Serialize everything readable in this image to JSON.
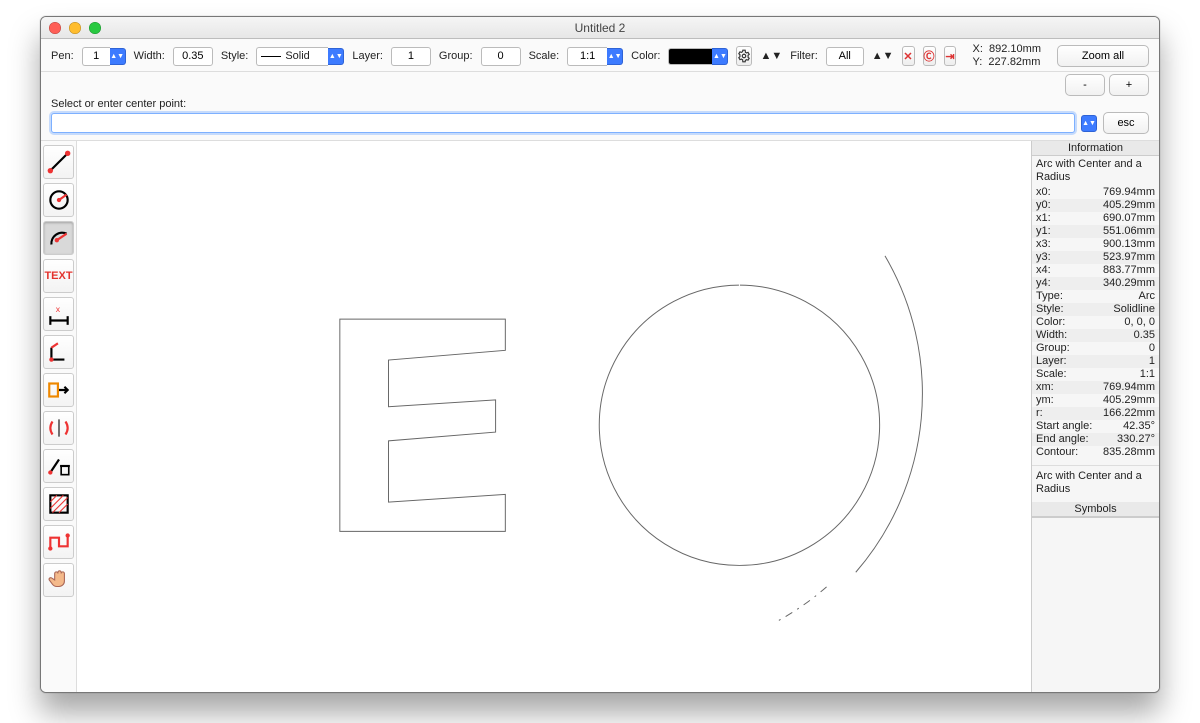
{
  "window": {
    "title": "Untitled 2"
  },
  "toolbar": {
    "pen_label": "Pen:",
    "pen_value": "1",
    "width_label": "Width:",
    "width_value": "0.35",
    "style_label": "Style:",
    "style_value": "Solid",
    "layer_label": "Layer:",
    "layer_value": "1",
    "group_label": "Group:",
    "group_value": "0",
    "scale_label": "Scale:",
    "scale_value": "1:1",
    "color_label": "Color:",
    "filter_label": "Filter:",
    "filter_value": "All",
    "zoom_all": "Zoom all",
    "x_label": "X:",
    "x_value": "892.10mm",
    "y_label": "Y:",
    "y_value": "227.82mm"
  },
  "command": {
    "hint": "Select or enter center point:",
    "minus": "-",
    "plus": "+",
    "esc": "esc"
  },
  "tools": [
    {
      "name": "line-tool",
      "selected": false
    },
    {
      "name": "circle-tool",
      "selected": false
    },
    {
      "name": "arc-tool",
      "selected": true
    },
    {
      "name": "text-tool",
      "selected": false
    },
    {
      "name": "dimension-tool",
      "selected": false
    },
    {
      "name": "corner-tool",
      "selected": false
    },
    {
      "name": "insert-tool",
      "selected": false
    },
    {
      "name": "mirror-tool",
      "selected": false
    },
    {
      "name": "trash-tool",
      "selected": false
    },
    {
      "name": "hatch-tool",
      "selected": false
    },
    {
      "name": "polyline-tool",
      "selected": false
    },
    {
      "name": "pan-tool",
      "selected": false
    }
  ],
  "info": {
    "header": "Information",
    "section1": "Arc with Center and a Radius",
    "rows": [
      {
        "k": "x0:",
        "v": "769.94mm"
      },
      {
        "k": "y0:",
        "v": "405.29mm"
      },
      {
        "k": "x1:",
        "v": "690.07mm"
      },
      {
        "k": "y1:",
        "v": "551.06mm"
      },
      {
        "k": "x3:",
        "v": "900.13mm"
      },
      {
        "k": "y3:",
        "v": "523.97mm"
      },
      {
        "k": "x4:",
        "v": "883.77mm"
      },
      {
        "k": "y4:",
        "v": "340.29mm"
      },
      {
        "k": "Type:",
        "v": "Arc"
      },
      {
        "k": "Style:",
        "v": "Solidline"
      },
      {
        "k": "Color:",
        "v": "0, 0, 0"
      },
      {
        "k": "Width:",
        "v": "0.35"
      },
      {
        "k": "Group:",
        "v": "0"
      },
      {
        "k": "Layer:",
        "v": "1"
      },
      {
        "k": "Scale:",
        "v": "1:1"
      },
      {
        "k": "xm:",
        "v": "769.94mm"
      },
      {
        "k": "ym:",
        "v": "405.29mm"
      },
      {
        "k": "r:",
        "v": "166.22mm"
      },
      {
        "k": "Start angle:",
        "v": "42.35°"
      },
      {
        "k": "End angle:",
        "v": "330.27°"
      },
      {
        "k": "Contour:",
        "v": "835.28mm"
      }
    ],
    "section2": "Arc with Center and a Radius",
    "symbols_hdr": "Symbols"
  }
}
